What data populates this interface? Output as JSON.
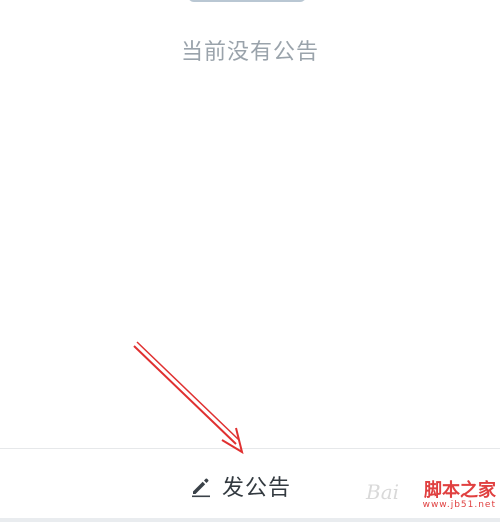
{
  "empty_state": {
    "message": "当前没有公告"
  },
  "bottom_bar": {
    "post_button_label": "发公告",
    "post_icon": "pencil-icon"
  },
  "watermark": {
    "baidu_text": "Bai",
    "site_name": "脚本之家",
    "site_url": "www.jb51.net"
  },
  "colors": {
    "empty_text": "#9aa3ab",
    "label_text": "#333a40",
    "arrow": "#e03030",
    "divider": "#e6e8ea"
  }
}
